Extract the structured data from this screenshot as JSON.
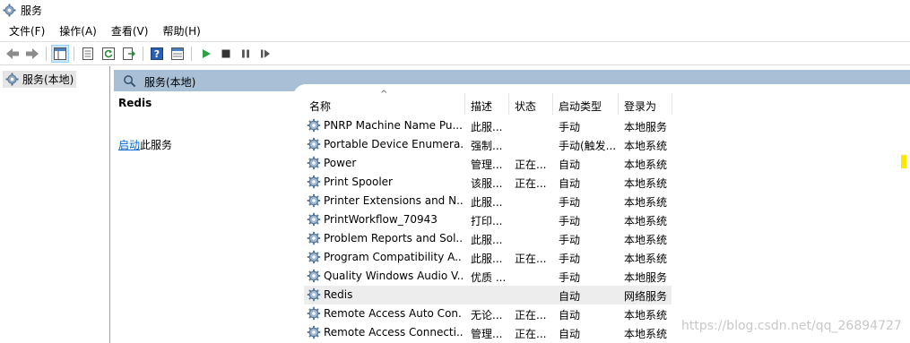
{
  "window": {
    "title": "服务"
  },
  "menubar": {
    "items": [
      "文件(F)",
      "操作(A)",
      "查看(V)",
      "帮助(H)"
    ]
  },
  "toolbar": {
    "buttons": [
      "back-icon",
      "forward-icon",
      "show-tree-icon",
      "properties-icon",
      "refresh-icon",
      "export-icon",
      "help-icon",
      "console-icon",
      "play-icon",
      "stop-icon",
      "pause-icon",
      "resume-icon"
    ]
  },
  "tree": {
    "root_label": "服务(本地)"
  },
  "pane": {
    "title": "服务(本地)"
  },
  "detail": {
    "service_name": "Redis",
    "action_link": "启动",
    "action_text": "此服务"
  },
  "table": {
    "columns": [
      "名称",
      "描述",
      "状态",
      "启动类型",
      "登录为"
    ],
    "rows": [
      {
        "name": "PNRP Machine Name Pu...",
        "desc": "此服...",
        "status": "",
        "start": "手动",
        "logon": "本地服务"
      },
      {
        "name": "Portable Device Enumera...",
        "desc": "强制...",
        "status": "",
        "start": "手动(触发...",
        "logon": "本地系统"
      },
      {
        "name": "Power",
        "desc": "管理...",
        "status": "正在...",
        "start": "自动",
        "logon": "本地系统"
      },
      {
        "name": "Print Spooler",
        "desc": "该服...",
        "status": "正在...",
        "start": "自动",
        "logon": "本地系统"
      },
      {
        "name": "Printer Extensions and N...",
        "desc": "此服...",
        "status": "",
        "start": "手动",
        "logon": "本地系统"
      },
      {
        "name": "PrintWorkflow_70943",
        "desc": "打印...",
        "status": "",
        "start": "手动",
        "logon": "本地系统"
      },
      {
        "name": "Problem Reports and Sol...",
        "desc": "此服...",
        "status": "",
        "start": "手动",
        "logon": "本地系统"
      },
      {
        "name": "Program Compatibility A...",
        "desc": "此服...",
        "status": "正在...",
        "start": "手动",
        "logon": "本地系统"
      },
      {
        "name": "Quality Windows Audio V...",
        "desc": "优质 ...",
        "status": "",
        "start": "手动",
        "logon": "本地服务"
      },
      {
        "name": "Redis",
        "desc": "",
        "status": "",
        "start": "自动",
        "logon": "网络服务"
      },
      {
        "name": "Remote Access Auto Con...",
        "desc": "无论...",
        "status": "正在...",
        "start": "自动",
        "logon": "本地系统"
      },
      {
        "name": "Remote Access Connecti...",
        "desc": "管理...",
        "status": "正在...",
        "start": "自动",
        "logon": "本地系统"
      }
    ],
    "selected_row": 9
  },
  "watermark": "https://blog.csdn.net/qq_26894727",
  "colors": {
    "pane_header": "#a8bfd5",
    "selected_row": "#ededed",
    "link": "#0066cc",
    "play": "#2ea043"
  }
}
